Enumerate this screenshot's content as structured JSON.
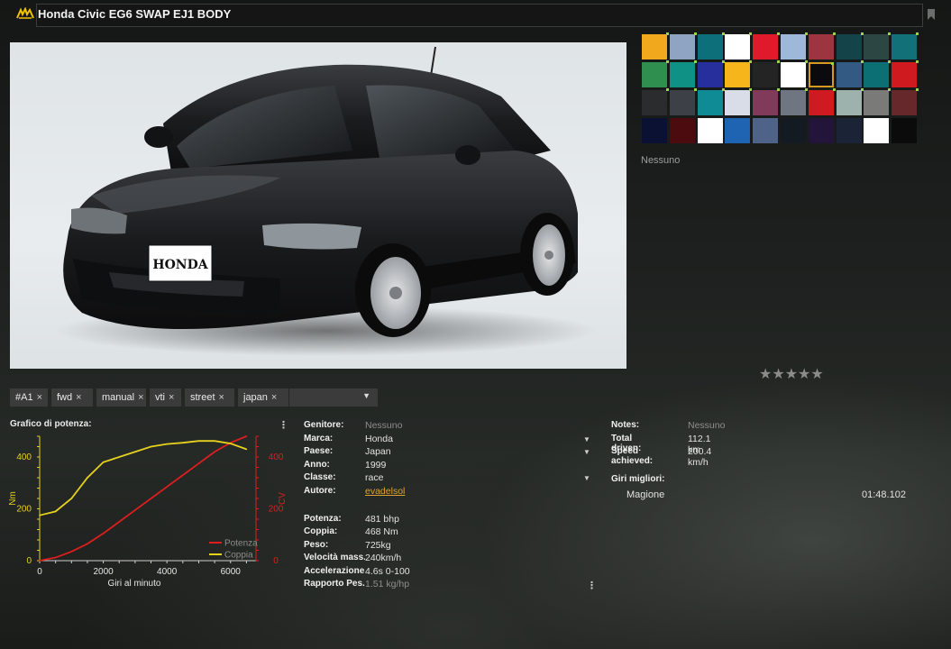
{
  "window": {
    "title": "Honda Civic EG6 SWAP EJ1 BODY",
    "logo_icon": "brand-logo-icon",
    "bookmark_icon": "bookmark-icon"
  },
  "preview": {
    "plate_text": "HONDA"
  },
  "skins": {
    "colors": [
      "#f2a81d",
      "#8fa3c2",
      "#0c6f7a",
      "#ffffff",
      "#e0192b",
      "#9db8d8",
      "#9c3540",
      "#15434a",
      "#2c4743",
      "#127078",
      "#2f8f4f",
      "#109186",
      "#262f9c",
      "#f7b51c",
      "#242424",
      "#ffffff",
      "#0b0b0f",
      "#335a82",
      "#0b6f73",
      "#cf1b1f",
      "#2a2c2e",
      "#3d4147",
      "#0f8b96",
      "#d9dde8",
      "#813a5a",
      "#707582",
      "#d01a22",
      "#9eb2ad",
      "#7a7a78",
      "#66282a",
      "#0b1133",
      "#4b0b0f",
      "#ffffff",
      "#1f64b3",
      "#4e6387",
      "#141a22",
      "#23153a",
      "#1b2436",
      "#ffffff",
      "#0b0b0b"
    ],
    "selected_index": 16,
    "skin_name": "Nessuno"
  },
  "rating": {
    "stars": "★★★★★",
    "value": 0
  },
  "tags": [
    {
      "label": "#A1"
    },
    {
      "label": "fwd"
    },
    {
      "label": "manual"
    },
    {
      "label": "vti"
    },
    {
      "label": "street"
    },
    {
      "label": "japan"
    }
  ],
  "tag_remove_glyph": "×",
  "tag_dropdown_glyph": "▼",
  "graph": {
    "title": "Grafico di potenza:",
    "menu_glyph": "⋮"
  },
  "chart_data": {
    "type": "line",
    "xlabel": "Giri al minuto",
    "ylabel_left": "Nm",
    "ylabel_right": "CV",
    "x_ticks": [
      "0",
      "2000",
      "4000",
      "6000"
    ],
    "y_left_ticks": [
      "0",
      "200",
      "400"
    ],
    "y_right_ticks": [
      "0",
      "200",
      "400"
    ],
    "xlim": [
      0,
      6800
    ],
    "ylim": [
      0,
      480
    ],
    "legend_position": "bottom-right",
    "series": [
      {
        "name": "Potenza",
        "color": "#dc1e1e",
        "axis": "right",
        "x": [
          0,
          500,
          1000,
          1500,
          2000,
          2500,
          3000,
          3500,
          4000,
          4500,
          5000,
          5500,
          6000,
          6500
        ],
        "y": [
          0,
          12,
          35,
          65,
          105,
          150,
          195,
          240,
          285,
          330,
          375,
          420,
          455,
          480
        ]
      },
      {
        "name": "Coppia",
        "color": "#e6d21e",
        "axis": "left",
        "x": [
          0,
          500,
          1000,
          1500,
          2000,
          2500,
          3000,
          3500,
          4000,
          4500,
          5000,
          5500,
          6000,
          6500
        ],
        "y": [
          175,
          190,
          240,
          320,
          380,
          400,
          420,
          440,
          450,
          455,
          462,
          462,
          452,
          430
        ]
      }
    ]
  },
  "props": {
    "rows": [
      {
        "label": "Genitore:",
        "value": "Nessuno"
      },
      {
        "label": "Marca:",
        "value": "Honda"
      },
      {
        "label": "Paese:",
        "value": "Japan"
      },
      {
        "label": "Anno:",
        "value": "1999"
      },
      {
        "label": "Classe:",
        "value": "race"
      },
      {
        "label": "Autore:",
        "value": "evadelsol"
      },
      {
        "label": "Potenza:",
        "value": "481 bhp"
      },
      {
        "label": "Coppia:",
        "value": "468 Nm"
      },
      {
        "label": "Peso:",
        "value": "725kg"
      },
      {
        "label": "Velocità mass...",
        "value": "240km/h"
      },
      {
        "label": "Accelerazione:",
        "value": "4.6s 0-100"
      },
      {
        "label": "Rapporto Pes...",
        "value": "1.51 kg/hp"
      }
    ],
    "dropdown_glyph": "▼",
    "menu_glyph": "⋮"
  },
  "stats": {
    "notes_label": "Notes:",
    "notes_value": "Nessuno",
    "driven_label": "Total driven:",
    "driven_value": "112.1 km",
    "speed_label": "Speed achieved:",
    "speed_value": "200.4 km/h",
    "best_laps_title": "Giri migliori:",
    "best_laps": [
      {
        "track": "Magione",
        "time": "01:48.102"
      }
    ]
  }
}
